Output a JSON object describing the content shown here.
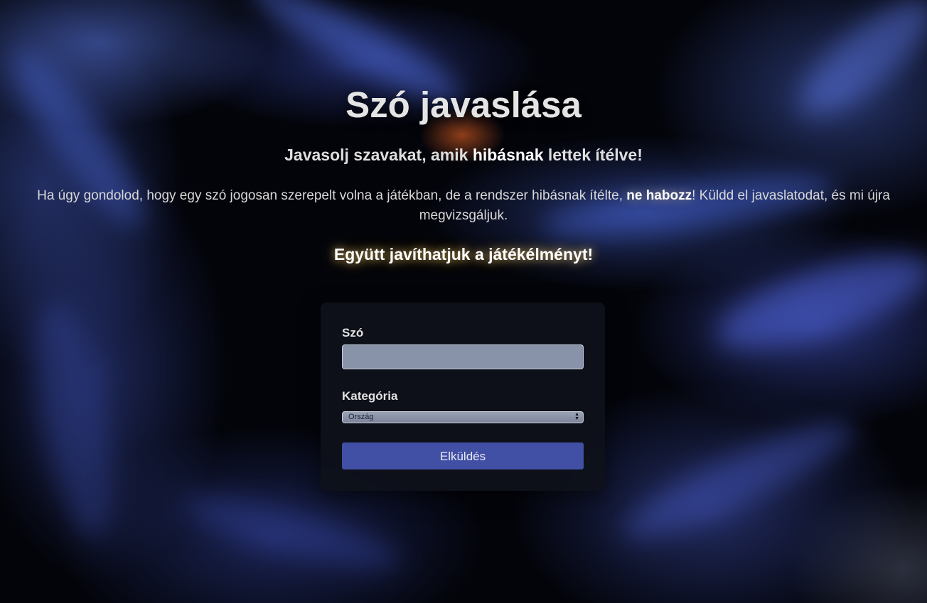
{
  "page": {
    "title": "Szó javaslása",
    "subtitle_pre": "Javasolj szavakat, amik ",
    "subtitle_strong": "hibásnak",
    "subtitle_post": " lettek ítélve!",
    "description_pre": "Ha úgy gondolod, hogy egy szó jogosan szerepelt volna a játékban, de a rendszer hibásnak ítélte, ",
    "description_bold": "ne habozz",
    "description_post": "! Küldd el javaslatodat, és mi újra megvizsgáljuk.",
    "motto": "Együtt javíthatjuk a játékélményt!"
  },
  "form": {
    "word_label": "Szó",
    "word_value": "",
    "category_label": "Kategória",
    "category_selected": "Ország",
    "submit_label": "Elküldés"
  },
  "colors": {
    "accent_button": "#4150a4",
    "card_background": "#0e111a",
    "glow": "#ffd76e"
  },
  "icons": {
    "select_arrows": "chevron-up-down-icon"
  }
}
